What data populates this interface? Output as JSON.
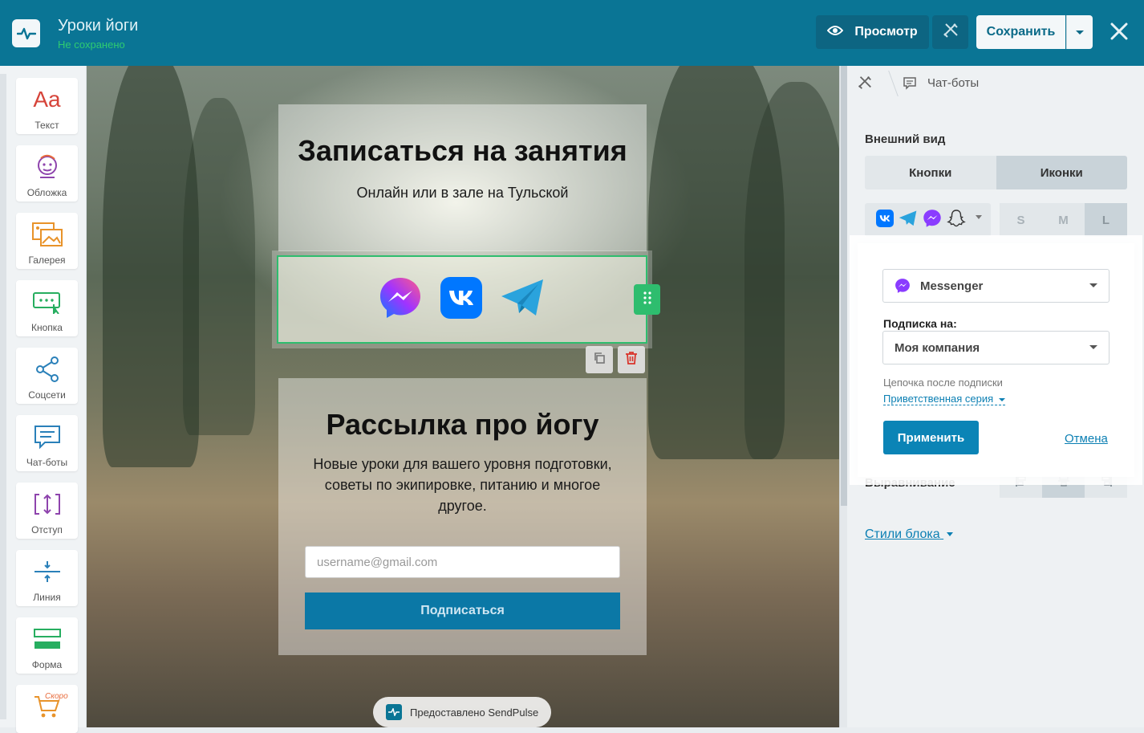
{
  "header": {
    "title": "Уроки йоги",
    "status": "Не сохранено",
    "preview_label": "Просмотр",
    "save_label": "Сохранить"
  },
  "sidebar": {
    "items": [
      {
        "label": "Текст",
        "icon": "text-aa-icon"
      },
      {
        "label": "Обложка",
        "icon": "cover-icon"
      },
      {
        "label": "Галерея",
        "icon": "gallery-icon"
      },
      {
        "label": "Кнопка",
        "icon": "button-icon"
      },
      {
        "label": "Соцсети",
        "icon": "share-icon"
      },
      {
        "label": "Чат-боты",
        "icon": "chat-icon"
      },
      {
        "label": "Отступ",
        "icon": "spacing-icon"
      },
      {
        "label": "Линия",
        "icon": "line-icon"
      },
      {
        "label": "Форма",
        "icon": "form-icon"
      }
    ],
    "soon_label": "Скоро"
  },
  "canvas": {
    "card1": {
      "title": "Записаться на занятия",
      "subtitle": "Онлайн или в зале на Тульской"
    },
    "social_icons": [
      "messenger-icon",
      "vk-icon",
      "telegram-icon"
    ],
    "card2": {
      "title": "Рассылка про йогу",
      "text": "Новые уроки для вашего уровня подготовки, советы по экипировке, питанию и многое другое."
    },
    "email_placeholder": "username@gmail.com",
    "subscribe_label": "Подписаться",
    "powered_by": "Предоставлено SendPulse"
  },
  "panel": {
    "breadcrumb": "Чат-боты",
    "appearance_title": "Внешний вид",
    "seg_buttons": "Кнопки",
    "seg_icons": "Иконки",
    "sizes": [
      "S",
      "M",
      "L"
    ],
    "selected_size": "L",
    "alignment_title": "Выравнивание",
    "block_styles": "Стили блока"
  },
  "popup": {
    "messenger_value": "Messenger",
    "subscription_label": "Подписка на:",
    "company_value": "Моя компания",
    "chain_label": "Цепочка после подписки",
    "chain_value": "Приветственная серия",
    "apply_label": "Применить",
    "cancel_label": "Отмена"
  },
  "colors": {
    "topbar": "#0a7595",
    "accent": "#0b84b6",
    "selection": "#2ebd6e",
    "status_green": "#2ecc71"
  }
}
